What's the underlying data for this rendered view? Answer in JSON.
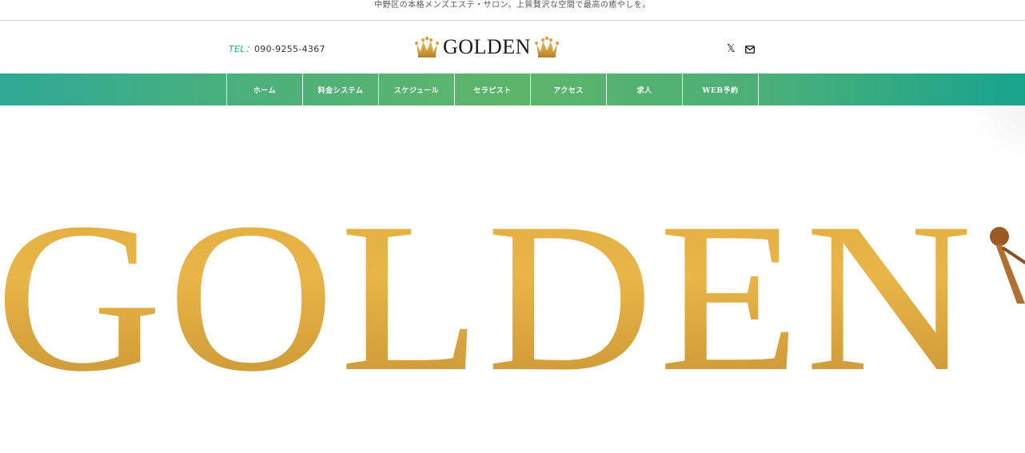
{
  "topbar": {
    "tagline": "中野区の本格メンズエステ・サロン。上質贅沢な空間で最高の癒やしを。"
  },
  "header": {
    "tel_label": "TEL：",
    "tel_number": "090-9255-4367",
    "logo_text": "GOLDEN",
    "logo_icon": "crown-icon",
    "social": [
      {
        "name": "x-icon",
        "glyph": "𝕏"
      },
      {
        "name": "mail-icon"
      }
    ]
  },
  "nav": {
    "items": [
      {
        "label": "ホーム"
      },
      {
        "label": "料金システム"
      },
      {
        "label": "スケジュール"
      },
      {
        "label": "セラピスト"
      },
      {
        "label": "アクセス"
      },
      {
        "label": "求人"
      },
      {
        "label": "WEB予約"
      }
    ]
  },
  "hero": {
    "banner_text": "GOLDEN"
  },
  "colors": {
    "accent": "#2aa58c",
    "gold": "#e2ad3f",
    "nav_start": "#2ea996",
    "nav_mid": "#5db56a",
    "nav_end": "#17a48e"
  }
}
